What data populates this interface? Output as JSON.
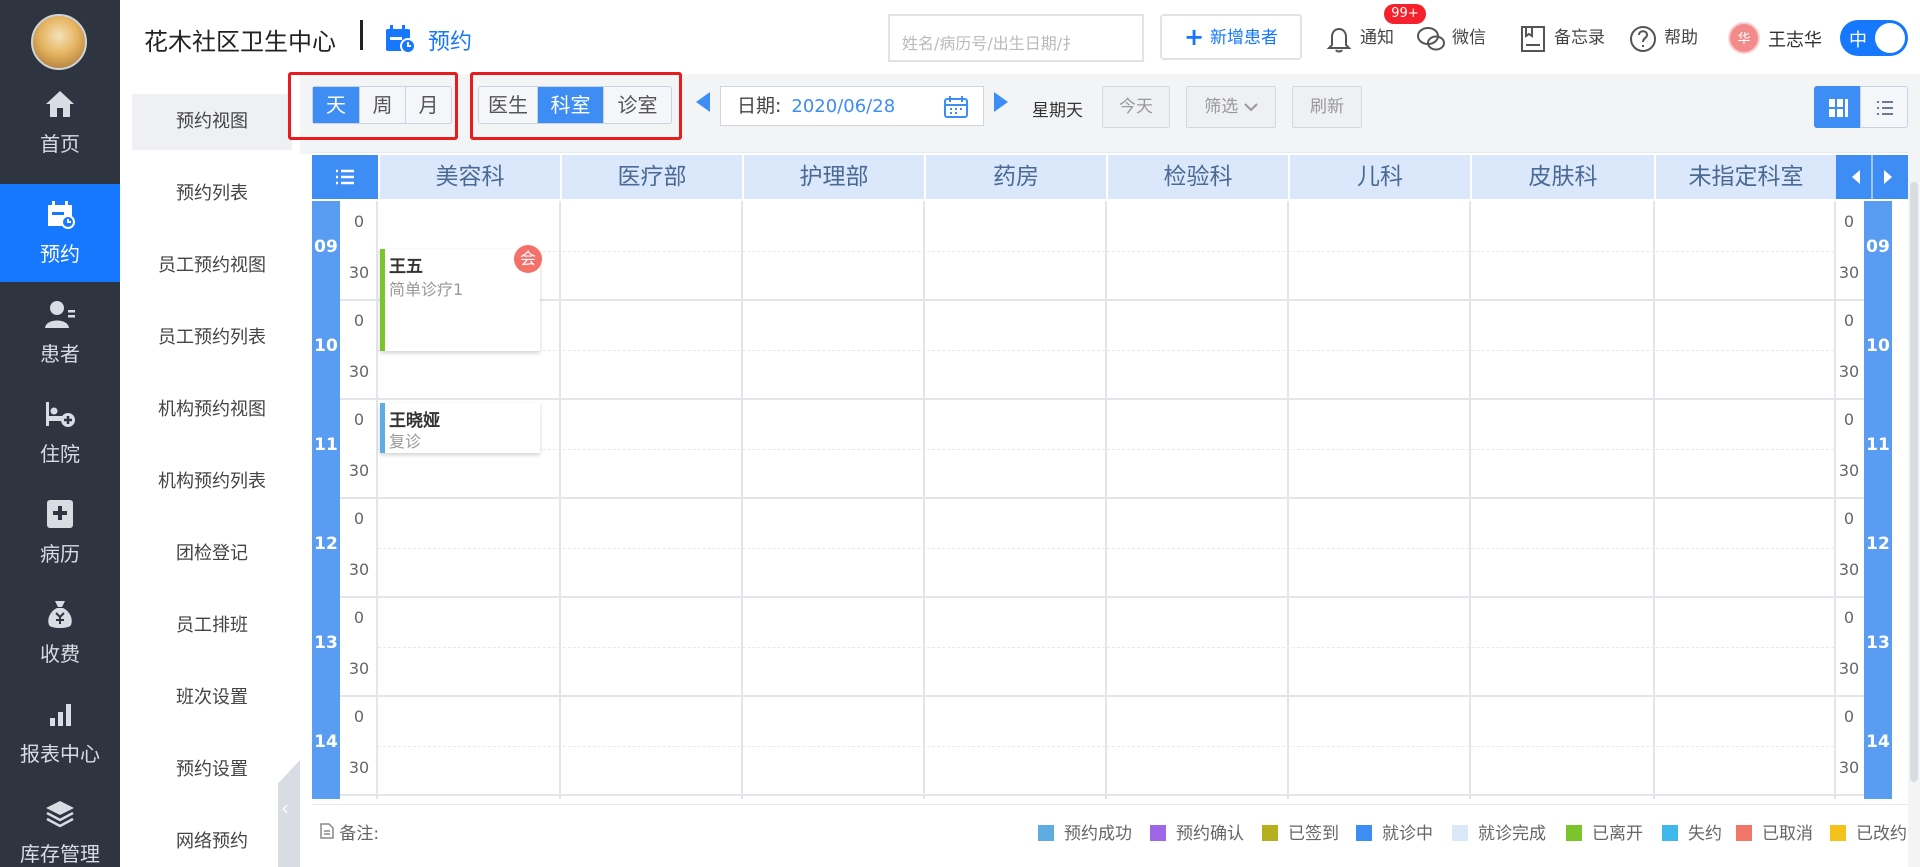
{
  "nav": {
    "items": [
      {
        "label": "首页",
        "icon": "home-icon"
      },
      {
        "label": "预约",
        "icon": "calendar-icon",
        "active": true
      },
      {
        "label": "患者",
        "icon": "patient-icon"
      },
      {
        "label": "住院",
        "icon": "bed-icon"
      },
      {
        "label": "病历",
        "icon": "medical-record-icon"
      },
      {
        "label": "收费",
        "icon": "money-bag-icon"
      },
      {
        "label": "报表中心",
        "icon": "bar-chart-icon"
      },
      {
        "label": "库存管理",
        "icon": "layers-icon"
      }
    ]
  },
  "subnav": {
    "items": [
      "预约视图",
      "预约列表",
      "员工预约视图",
      "员工预约列表",
      "机构预约视图",
      "机构预约列表",
      "团检登记",
      "员工排班",
      "班次设置",
      "预约设置",
      "网络预约"
    ],
    "active_index": 0,
    "collapse_glyph": "‹"
  },
  "header": {
    "org_name": "花木社区卫生中心",
    "page_name": "预约",
    "search_placeholder": "姓名/病历号/出生日期/扌",
    "add_patient": "新增患者",
    "add_glyph": "+",
    "notify": "通知",
    "notify_badge": "99+",
    "wechat": "微信",
    "memo": "备忘录",
    "help": "帮助",
    "user_initial": "华",
    "user_name": "王志华",
    "lang_toggle": "中"
  },
  "toolbar": {
    "period_tabs": [
      "天",
      "周",
      "月"
    ],
    "period_active": 0,
    "group_tabs": [
      "医生",
      "科室",
      "诊室"
    ],
    "group_active": 1,
    "date_label": "日期:",
    "date_value": "2020/06/28",
    "weekday": "星期天",
    "today": "今天",
    "filter": "筛选",
    "refresh": "刷新"
  },
  "schedule": {
    "departments": [
      "美容科",
      "医疗部",
      "护理部",
      "药房",
      "检验科",
      "儿科",
      "皮肤科",
      "未指定科室"
    ],
    "hours": [
      "09",
      "10",
      "11",
      "12",
      "13",
      "14"
    ],
    "minute_marks": [
      "0",
      "30"
    ],
    "appointments": [
      {
        "name": "王五",
        "desc": "简单诊疗1",
        "department": "美容科",
        "badge": "会",
        "status_color": "#7ac52b"
      },
      {
        "name": "王晓娅",
        "desc": "复诊",
        "department": "美容科",
        "badge": "",
        "status_color": "#5dade2"
      }
    ]
  },
  "footer": {
    "note_label": "备注:",
    "legend": [
      {
        "label": "预约成功",
        "color": "#5dade2"
      },
      {
        "label": "预约确认",
        "color": "#a066e8"
      },
      {
        "label": "已签到",
        "color": "#b7b01e"
      },
      {
        "label": "就诊中",
        "color": "#3d8df5"
      },
      {
        "label": "就诊完成",
        "color": "#dbe8f7"
      },
      {
        "label": "已离开",
        "color": "#7ac52b"
      },
      {
        "label": "失约",
        "color": "#3fb8ec"
      },
      {
        "label": "已取消",
        "color": "#f0766a"
      },
      {
        "label": "已改约",
        "color": "#f5c21b"
      }
    ]
  }
}
